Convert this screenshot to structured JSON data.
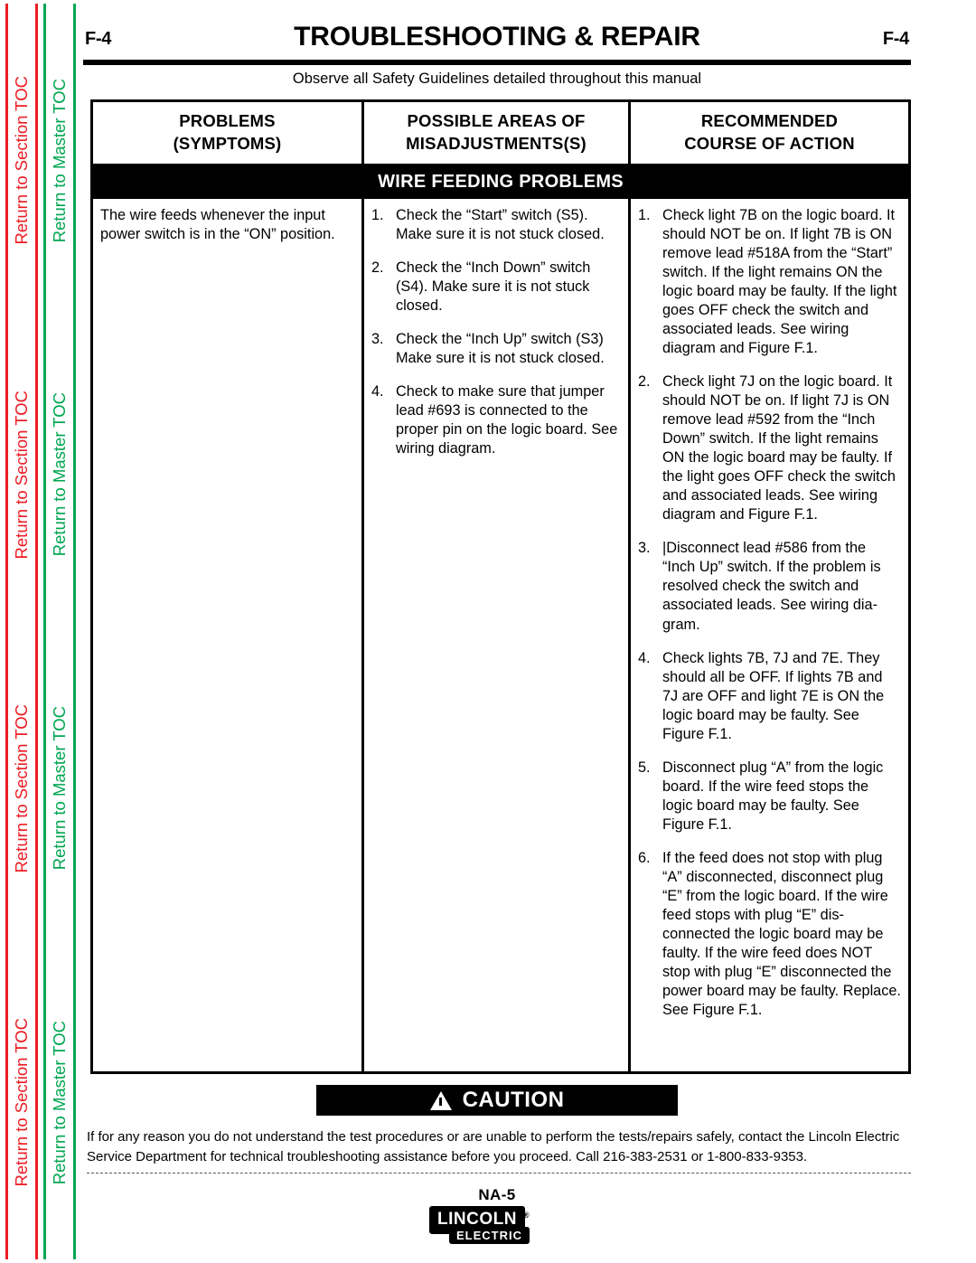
{
  "sidebar": {
    "section_toc_label": "Return to Section TOC",
    "master_toc_label": "Return to Master TOC",
    "section_toc_color": "#ED1C24",
    "master_toc_color": "#00A651",
    "repeat_count": 4
  },
  "header": {
    "page_number_left": "F-4",
    "page_number_right": "F-4",
    "title": "TROUBLESHOOTING & REPAIR",
    "safety_note": "Observe all Safety Guidelines detailed throughout this manual"
  },
  "table": {
    "columns": [
      {
        "line1": "PROBLEMS",
        "line2": "(SYMPTOMS)"
      },
      {
        "line1": "POSSIBLE AREAS OF",
        "line2": "MISADJUSTMENTS(S)"
      },
      {
        "line1": "RECOMMENDED",
        "line2": "COURSE OF ACTION"
      }
    ],
    "section_band": "WIRE FEEDING PROBLEMS",
    "symptom": "The wire feeds whenever the input power switch is in the “ON” position.",
    "possible_areas": [
      {
        "num": "1.",
        "text": "Check the “Start” switch (S5).  Make sure it is not stuck closed."
      },
      {
        "num": "2.",
        "text": "Check the “Inch Down” switch (S4).  Make sure it is not stuck closed."
      },
      {
        "num": "3.",
        "text": "Check the “Inch Up” switch (S3) Make sure it is not stuck closed."
      },
      {
        "num": "4.",
        "text": "Check to make sure that jumper lead #693 is connected to the proper pin on the logic board. See wiring diagram."
      }
    ],
    "recommended_actions": [
      {
        "num": "1.",
        "text": "Check light 7B on the logic board.  It should NOT be on.  If light 7B is ON remove lead #518A from the “Start” switch.  If the light remains ON the logic board may be faulty.  If the light goes OFF check the switch and associated leads.  See wiring diagram and Figure F.1."
      },
      {
        "num": "2.",
        "text": "Check light 7J on the logic board.  It should NOT be on.  If light 7J is ON remove lead #592 from the “Inch Down” switch.  If the light remains ON the logic board may be faulty.  If the light goes OFF check the switch and associated leads.  See wiring diagram and Figure F.1."
      },
      {
        "num": "3.",
        "text": "|Disconnect lead #586 from the “Inch Up” switch.    If the problem is resolved check the switch and associated leads.  See wiring dia-gram."
      },
      {
        "num": "4.",
        "text": "Check lights 7B, 7J and 7E.  They should all be OFF.  If lights 7B and 7J are OFF and light 7E is ON the logic board may be faulty. See Figure F.1."
      },
      {
        "num": "5.",
        "text": "Disconnect plug “A” from the logic board.  If the wire feed stops the logic board may be faulty.  See Figure F.1."
      },
      {
        "num": "6.",
        "text": "If the feed does not stop with plug “A” disconnected, disconnect plug “E” from the logic board.  If the wire feed stops with plug “E” dis-connected the logic board may be faulty.  If the wire feed does NOT stop with plug “E” disconnected the power board may be faulty.  Replace.  See Figure F.1."
      }
    ]
  },
  "caution": {
    "label": "CAUTION",
    "icon": "warning-triangle-icon",
    "body": "If for any reason you do not understand the test procedures or are unable to perform the tests/repairs safely, contact the Lincoln Electric Service Department for technical troubleshooting assistance before you proceed. Call 216-383-2531 or 1-800-833-9353."
  },
  "footer": {
    "model": "NA-5",
    "brand_top": "LINCOLN",
    "brand_registered": "®",
    "brand_bottom": "ELECTRIC"
  }
}
